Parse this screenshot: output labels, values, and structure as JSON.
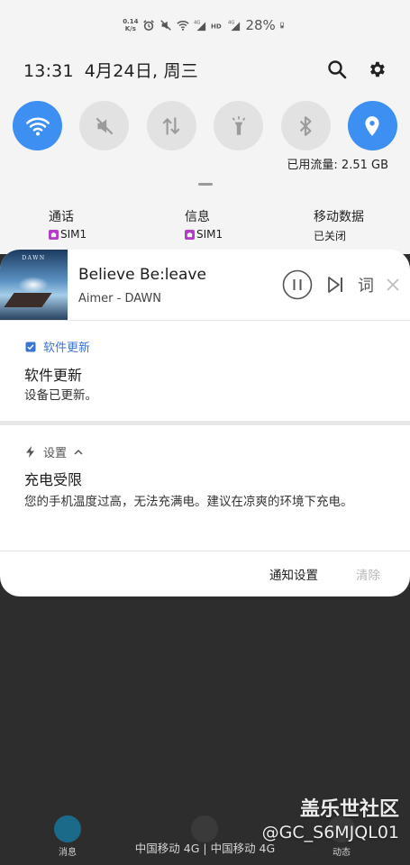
{
  "status_bar": {
    "net_speed_value": "0.14",
    "net_speed_unit": "K/s",
    "battery_percent": "28%",
    "icons": [
      "alarm-icon",
      "mute-icon",
      "wifi-icon",
      "signal-4g-icon",
      "hd-icon",
      "signal-4g-icon",
      "battery-icon"
    ]
  },
  "header": {
    "time": "13:31",
    "date": "4月24日, 周三",
    "icons": [
      "search-icon",
      "gear-icon"
    ]
  },
  "quick_toggles": [
    {
      "name": "wifi",
      "icon": "wifi-icon",
      "on": true
    },
    {
      "name": "sound",
      "icon": "mute-icon",
      "on": false
    },
    {
      "name": "mobile-data",
      "icon": "data-transfer-icon",
      "on": false
    },
    {
      "name": "flashlight",
      "icon": "flashlight-icon",
      "on": false
    },
    {
      "name": "bluetooth",
      "icon": "bluetooth-icon",
      "on": false
    },
    {
      "name": "location",
      "icon": "location-icon",
      "on": true
    }
  ],
  "data_usage": "已用流量: 2.51 GB",
  "sim_settings": {
    "call": {
      "label": "通话",
      "value": "SIM1"
    },
    "message": {
      "label": "信息",
      "value": "SIM1"
    },
    "mobile_data": {
      "label": "移动数据",
      "value": "已关闭"
    }
  },
  "media": {
    "album_title": "DAWN",
    "song": "Believe Be:leave",
    "artist": "Aimer - DAWN",
    "lyrics_label": "词"
  },
  "notifications": [
    {
      "app": "软件更新",
      "app_icon": "update-check-icon",
      "title": "软件更新",
      "body": "设备已更新。",
      "accent": "#3a74d4"
    },
    {
      "app": "设置",
      "app_icon": "charging-bolt-icon",
      "title": "充电受限",
      "body": "您的手机温度过高，无法充满电。建议在凉爽的环境下充电。",
      "accent": "#555555"
    }
  ],
  "actions": {
    "settings": "通知设置",
    "clear": "清除"
  },
  "watermark": {
    "site": "盖乐世社区",
    "user": "@GC_S6MJQL01"
  },
  "dock": {
    "left_label": "消息",
    "right_label": "动态"
  },
  "carrier": "中国移动 4G | 中国移动 4G",
  "colors": {
    "accent_blue": "#3d8ff2",
    "toggle_off": "#e2e2e2",
    "shade_bg": "#f4f4f4",
    "sim_badge": "#b23ec6"
  }
}
